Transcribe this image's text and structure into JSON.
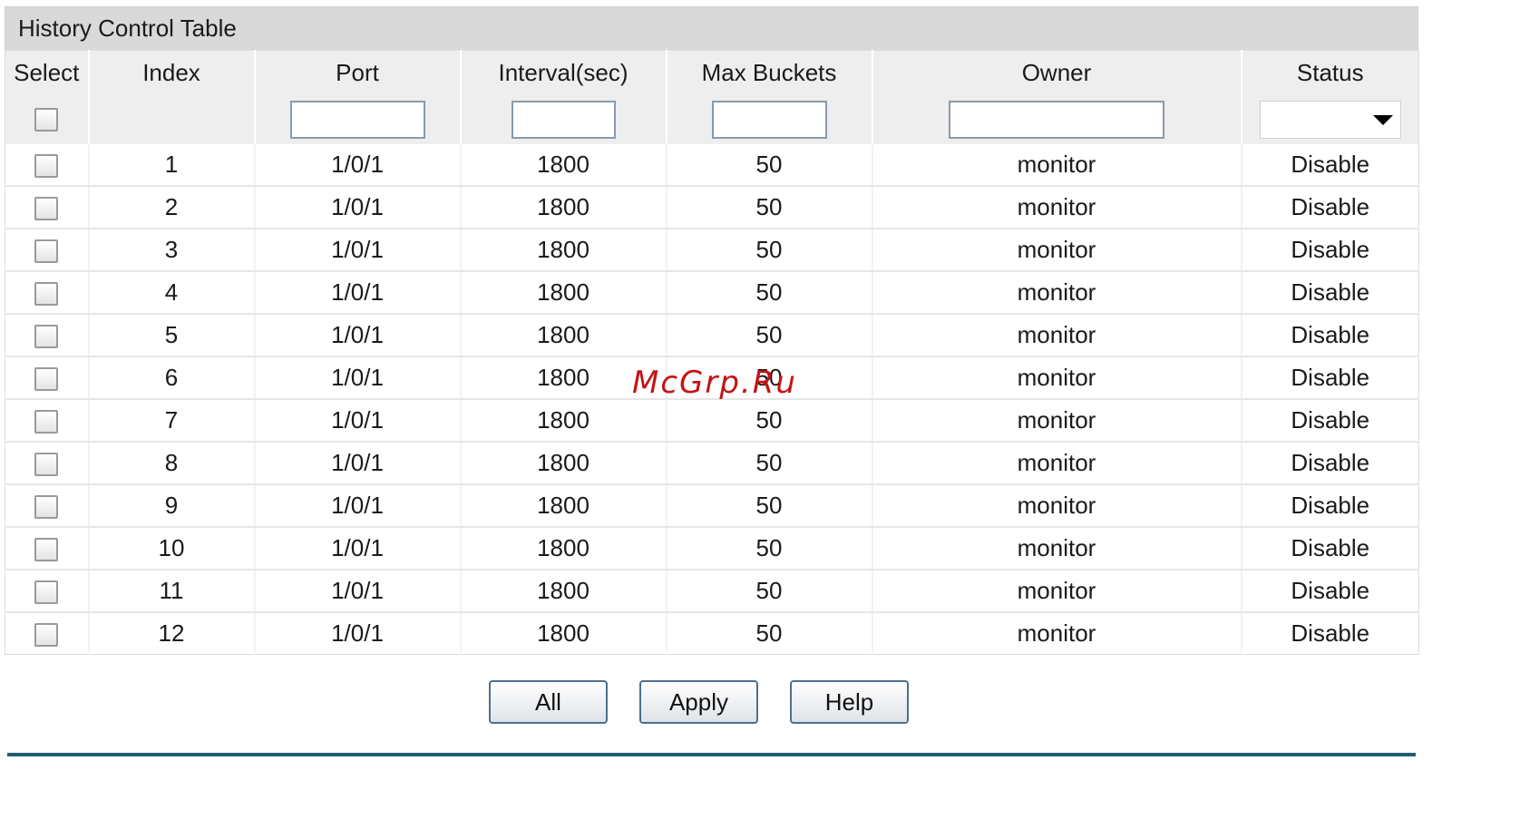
{
  "table": {
    "title": "History Control Table",
    "columns": [
      "Select",
      "Index",
      "Port",
      "Interval(sec)",
      "Max Buckets",
      "Owner",
      "Status"
    ],
    "filter": {
      "port_value": "",
      "interval_value": "",
      "max_buckets_value": "",
      "owner_value": "",
      "status_selected": ""
    },
    "rows": [
      {
        "index": "1",
        "port": "1/0/1",
        "interval": "1800",
        "max_buckets": "50",
        "owner": "monitor",
        "status": "Disable"
      },
      {
        "index": "2",
        "port": "1/0/1",
        "interval": "1800",
        "max_buckets": "50",
        "owner": "monitor",
        "status": "Disable"
      },
      {
        "index": "3",
        "port": "1/0/1",
        "interval": "1800",
        "max_buckets": "50",
        "owner": "monitor",
        "status": "Disable"
      },
      {
        "index": "4",
        "port": "1/0/1",
        "interval": "1800",
        "max_buckets": "50",
        "owner": "monitor",
        "status": "Disable"
      },
      {
        "index": "5",
        "port": "1/0/1",
        "interval": "1800",
        "max_buckets": "50",
        "owner": "monitor",
        "status": "Disable"
      },
      {
        "index": "6",
        "port": "1/0/1",
        "interval": "1800",
        "max_buckets": "50",
        "owner": "monitor",
        "status": "Disable"
      },
      {
        "index": "7",
        "port": "1/0/1",
        "interval": "1800",
        "max_buckets": "50",
        "owner": "monitor",
        "status": "Disable"
      },
      {
        "index": "8",
        "port": "1/0/1",
        "interval": "1800",
        "max_buckets": "50",
        "owner": "monitor",
        "status": "Disable"
      },
      {
        "index": "9",
        "port": "1/0/1",
        "interval": "1800",
        "max_buckets": "50",
        "owner": "monitor",
        "status": "Disable"
      },
      {
        "index": "10",
        "port": "1/0/1",
        "interval": "1800",
        "max_buckets": "50",
        "owner": "monitor",
        "status": "Disable"
      },
      {
        "index": "11",
        "port": "1/0/1",
        "interval": "1800",
        "max_buckets": "50",
        "owner": "monitor",
        "status": "Disable"
      },
      {
        "index": "12",
        "port": "1/0/1",
        "interval": "1800",
        "max_buckets": "50",
        "owner": "monitor",
        "status": "Disable"
      }
    ]
  },
  "buttons": {
    "all_label": "All",
    "apply_label": "Apply",
    "help_label": "Help"
  },
  "watermark": "McGrp.Ru",
  "colors": {
    "title_bar_bg": "#d9d9d9",
    "header_bg": "#eeeeee",
    "footer_line": "#1f5f73",
    "watermark": "#c41414",
    "button_border": "#4d6f8f"
  }
}
